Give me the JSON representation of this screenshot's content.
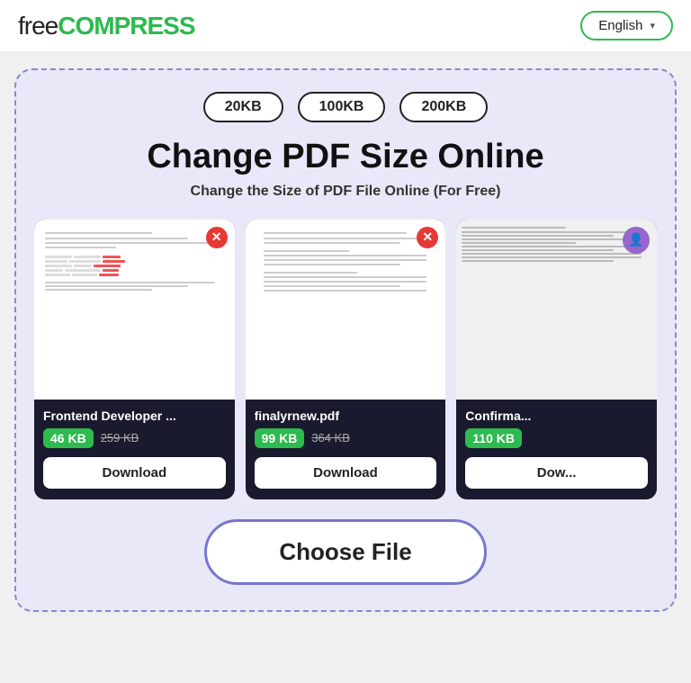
{
  "header": {
    "logo_free": "free",
    "logo_compress": "COMPRESS",
    "lang_label": "English",
    "lang_chevron": "▾"
  },
  "tool": {
    "size_presets": [
      "20KB",
      "100KB",
      "200KB"
    ],
    "title": "Change PDF Size Online",
    "subtitle": "Change the Size of PDF File Online (For Free)",
    "choose_file_label": "Choose File"
  },
  "cards": [
    {
      "filename": "Frontend Developer ...",
      "size_new": "46 KB",
      "size_old": "259 KB",
      "download_label": "Download"
    },
    {
      "filename": "finalyrnew.pdf",
      "size_new": "99 KB",
      "size_old": "364 KB",
      "download_label": "Download"
    },
    {
      "filename": "Confirma...",
      "size_new": "110 KB",
      "size_old": "",
      "download_label": "Dow..."
    }
  ]
}
